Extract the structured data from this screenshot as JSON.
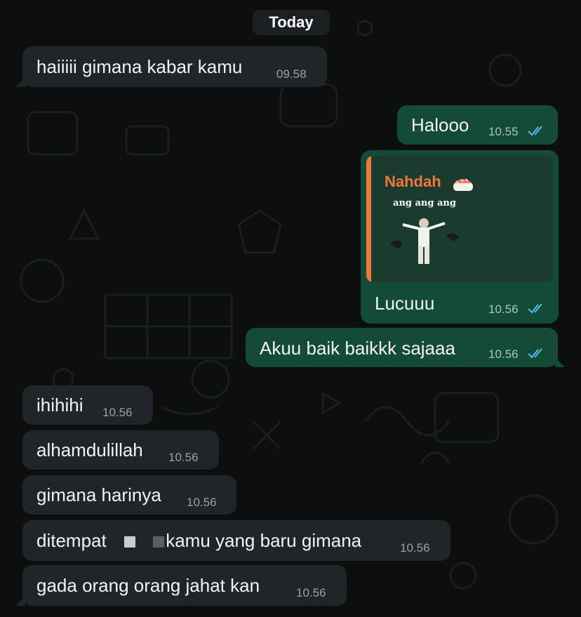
{
  "chat": {
    "date_separator": "Today",
    "messages": [
      {
        "direction": "in",
        "text": "haiiiii gimana kabar kamu",
        "time": "09.58"
      },
      {
        "direction": "out",
        "text": "Halooo",
        "time": "10.55",
        "status": "read"
      },
      {
        "direction": "out",
        "reply_to": {
          "sender": "Nahdah",
          "sticker_caption": "ang ang ang"
        },
        "text": "Lucuuu",
        "time": "10.56",
        "status": "read"
      },
      {
        "direction": "out",
        "text": "Akuu baik baikkk sajaaa",
        "time": "10.56",
        "status": "read"
      },
      {
        "direction": "in",
        "text": "ihihihi",
        "time": "10.56"
      },
      {
        "direction": "in",
        "text": "alhamdulillah",
        "time": "10.56"
      },
      {
        "direction": "in",
        "text": "gimana harinya",
        "time": "10.56"
      },
      {
        "direction": "in",
        "text_before": "ditempat",
        "text_after": "kamu yang baru gimana",
        "time": "10.56"
      },
      {
        "direction": "in",
        "text": "gada orang orang jahat kan",
        "time": "10.56"
      }
    ]
  },
  "colors": {
    "incoming_bubble": "#212529",
    "outgoing_bubble": "#134b36",
    "read_ticks": "#53bdeb",
    "reply_accent": "#f07a3c"
  },
  "icons": {
    "read_receipt": "double-check-icon",
    "reply_sender_emoji": "sushi-icon"
  }
}
